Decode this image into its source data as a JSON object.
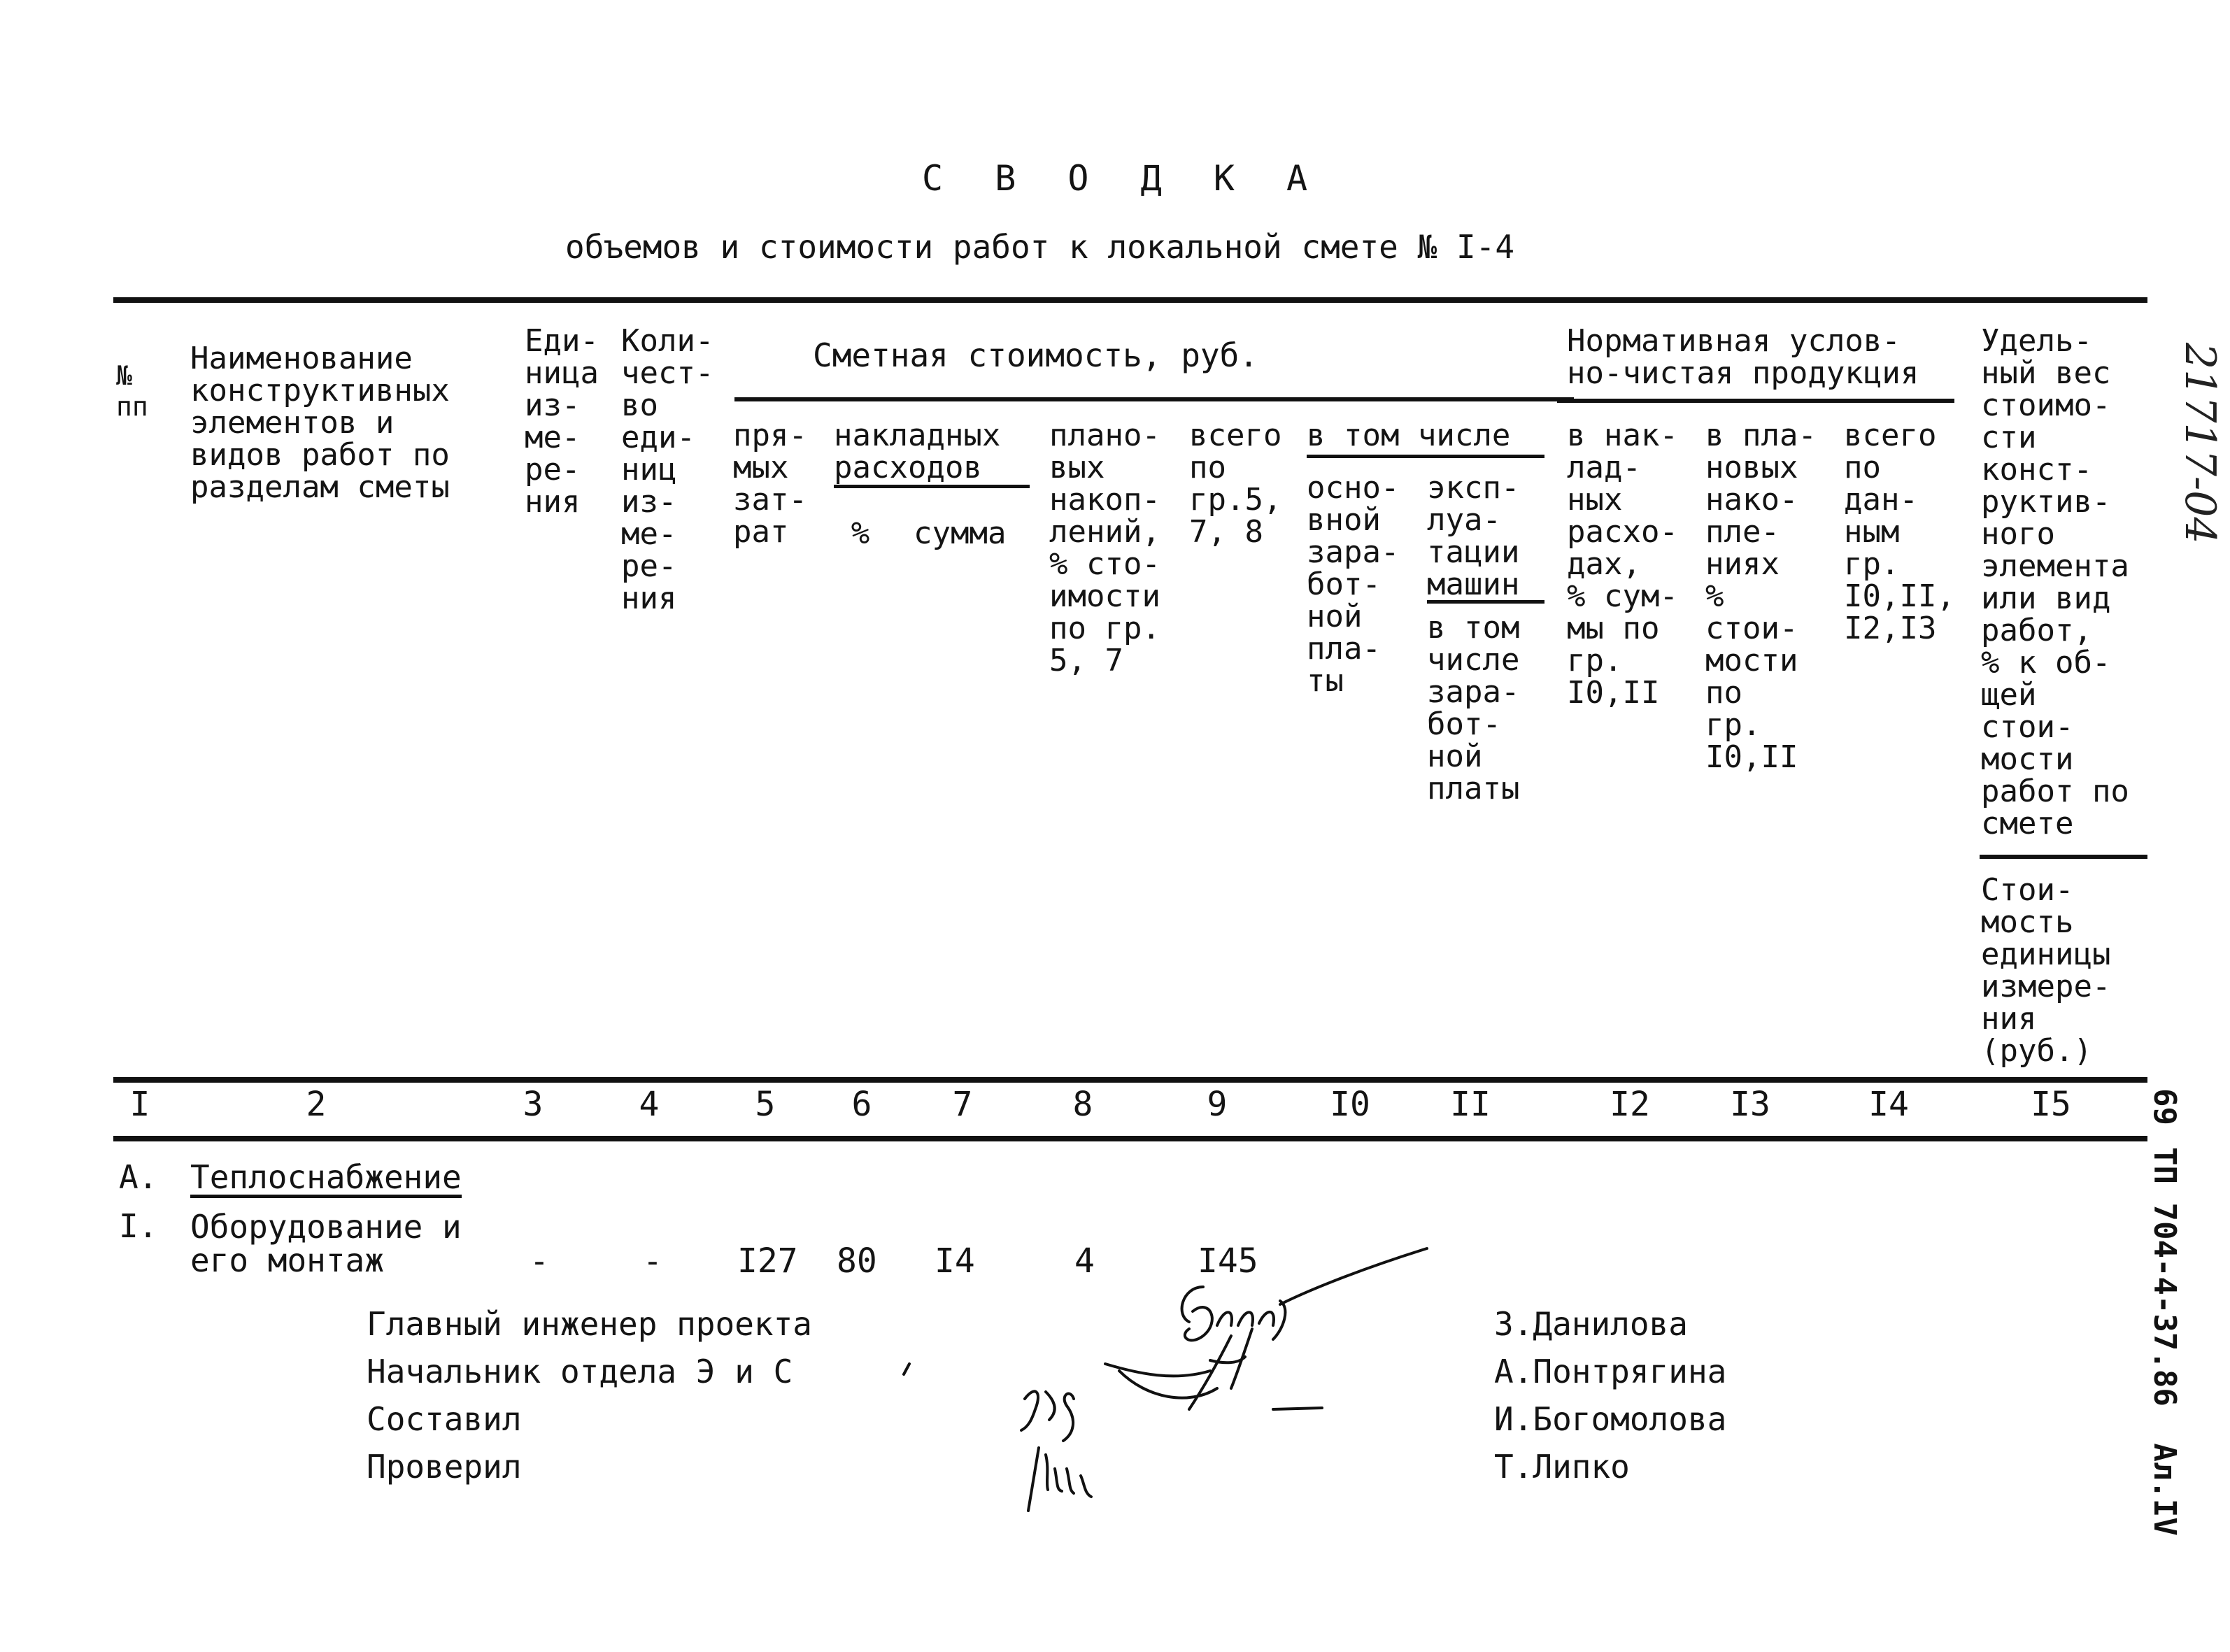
{
  "document": {
    "title": "С В О Д К А",
    "subtitle": "объемов и стоимости работ к локальной смете № I-4",
    "archive_number": "21717-04",
    "side_stamp": {
      "page_number": "69",
      "project_code": "ТП 704-4-37.86",
      "album": "Ал.IV"
    }
  },
  "table": {
    "header": {
      "col1": "№\nпп",
      "col2": "Наименование\nконструктивных\nэлементов и\nвидов работ по\nразделам сметы",
      "col3": "Еди-\nница\nиз-\nме-\nре-\nния",
      "col4": "Коли-\nчест-\nво\nеди-\nниц\nиз-\nме-\nре-\nния",
      "group_cost": "Сметная стоимость, руб.",
      "col5": "пря-\nмых\nзат-\nрат",
      "group_overhead": "накладных\nрасходов",
      "col6": "%",
      "col7": "сумма",
      "col8": "плано-\nвых\nнакоп-\nлений,\n% сто-\nимости\nпо гр.\n5, 7",
      "col9": "всего\nпо\nгр.5,\n7, 8",
      "group_incl": "в том числе",
      "col10": "осно-\nвной\nзара-\nбот-\nной\nпла-\nты",
      "col11_top": "эксп-\nлуа-\nтации\nмашин",
      "col11_bottom": "в том\nчисле\nзара-\nбот-\nной\nплаты",
      "group_norm": "Нормативная услов-\nно-чистая продукция",
      "col12": "в нак-\nлад-\nных\nрасхо-\nдах,\n% сум-\nмы по\nгр.\nI0,II",
      "col13": "в пла-\nновых\nнако-\nпле-\nниях\n%\nстои-\nмости\nпо\nгр.\nI0,II",
      "col14": "всего\nпо\nдан-\nным\nгр.\nI0,II,\nI2,I3",
      "col15_top": "Удель-\nный вес\nстоимо-\nсти\nконст-\nруктив-\nного\nэлемента\nили вид\nработ,\n% к об-\nщей\nстои-\nмости\nработ по\nсмете",
      "col15_bottom": "Стои-\nмость\nединицы\nизмере-\nния\n(руб.)"
    },
    "column_numbers": [
      "I",
      "2",
      "3",
      "4",
      "5",
      "6",
      "7",
      "8",
      "9",
      "I0",
      "II",
      "I2",
      "I3",
      "I4",
      "I5"
    ],
    "sections": [
      {
        "code": "А.",
        "title": "Теплоснабжение"
      }
    ],
    "rows": [
      {
        "num": "I.",
        "name": "Оборудование и\nего монтаж",
        "unit": "-",
        "qty": "-",
        "direct_costs": "I27",
        "overhead_pct": "80",
        "overhead_sum": "I4",
        "planned_savings": "4",
        "total": "I45"
      }
    ]
  },
  "signatures": [
    {
      "role": "Главный инженер проекта",
      "name": "З.Данилова"
    },
    {
      "role": "Начальник отдела Э и С",
      "name": "А.Понтрягина"
    },
    {
      "role": "Составил",
      "name": "И.Богомолова"
    },
    {
      "role": "Проверил",
      "name": "Т.Липко"
    }
  ]
}
